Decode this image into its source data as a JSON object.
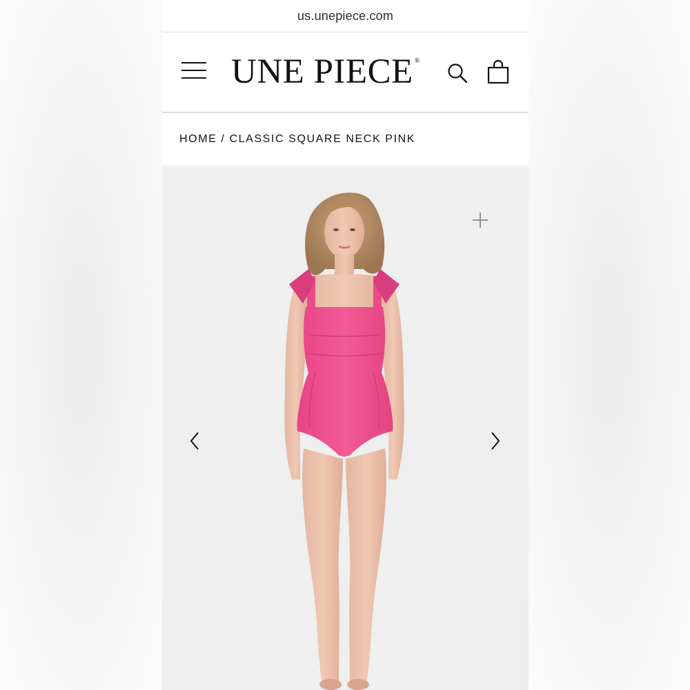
{
  "browser": {
    "url": "us.unepiece.com"
  },
  "header": {
    "logo_text": "UNE PIECE",
    "logo_mark": "®",
    "icons": {
      "menu": "hamburger-menu-icon",
      "search": "search-icon",
      "cart": "shopping-bag-icon"
    }
  },
  "breadcrumb": {
    "home": "HOME",
    "separator": "/",
    "current": "CLASSIC SQUARE NECK PINK"
  },
  "gallery": {
    "icons": {
      "zoom": "plus-icon",
      "prev": "chevron-left-icon",
      "next": "chevron-right-icon"
    }
  },
  "colors": {
    "swimsuit": "#f0508f",
    "background": "#efefef",
    "text": "#111111"
  }
}
